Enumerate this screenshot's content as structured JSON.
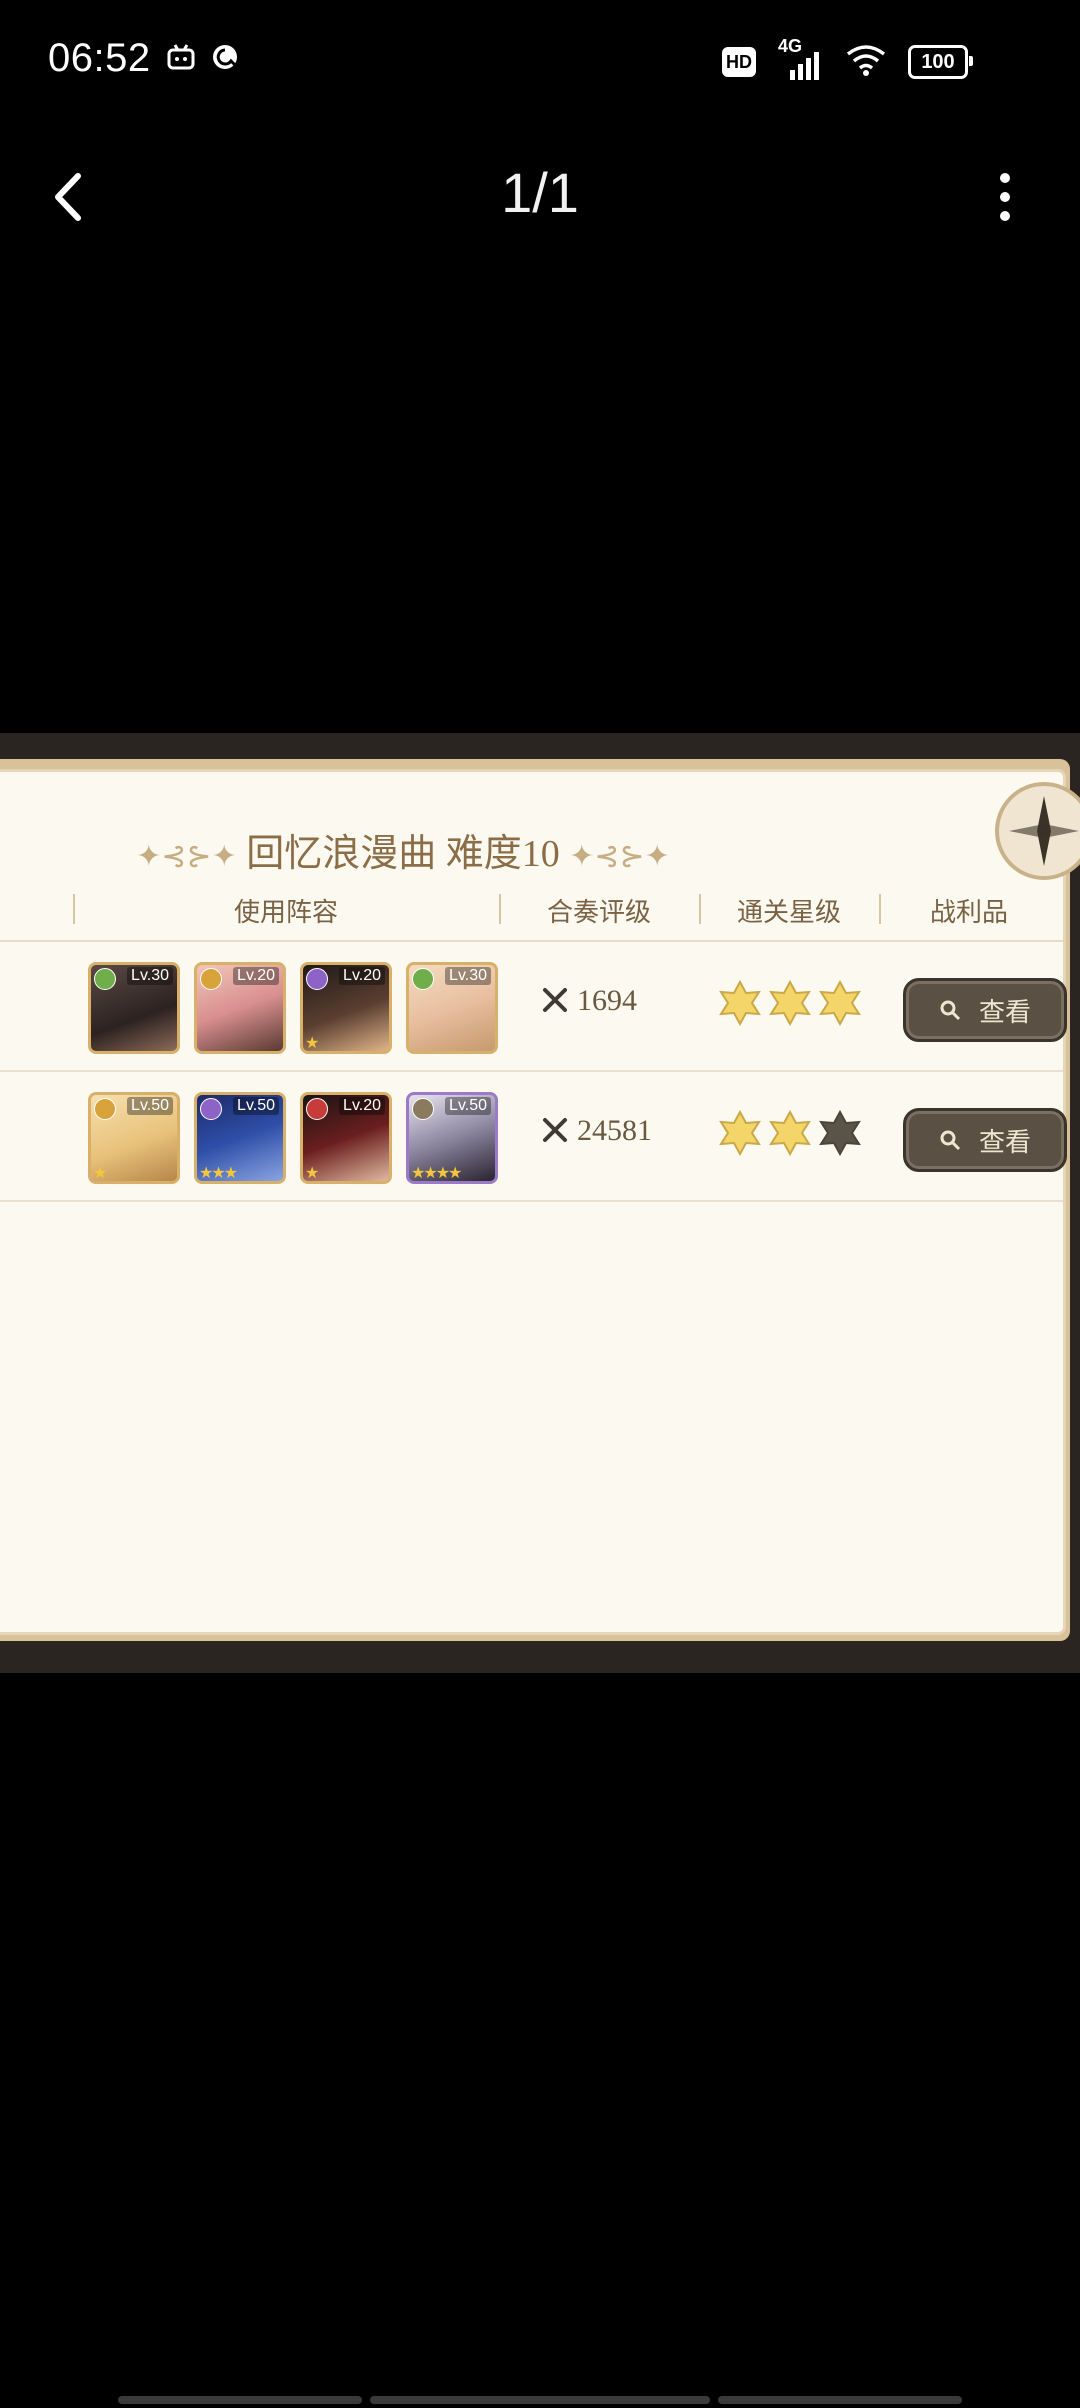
{
  "status_bar": {
    "time": "06:52",
    "hd_label": "HD",
    "network_label": "4G",
    "battery_level": "100"
  },
  "top_bar": {
    "page_counter": "1/1"
  },
  "panel": {
    "title": "回忆浪漫曲 难度10",
    "columns": [
      "使用阵容",
      "合奏评级",
      "通关星级",
      "战利品"
    ],
    "rows": [
      {
        "avatars": [
          {
            "level": "Lv.30",
            "stars": "",
            "element_color": "#6fae4a"
          },
          {
            "level": "Lv.20",
            "stars": "",
            "element_color": "#d9a33b"
          },
          {
            "level": "Lv.20",
            "stars": "★",
            "element_color": "#8e63c8"
          },
          {
            "level": "Lv.30",
            "stars": "",
            "element_color": "#6fae4a"
          }
        ],
        "score": "1694",
        "stars_filled": 3,
        "view_label": "查看"
      },
      {
        "avatars": [
          {
            "level": "Lv.50",
            "stars": "★",
            "element_color": "#d9a33b"
          },
          {
            "level": "Lv.50",
            "stars": "★★★",
            "element_color": "#8e63c8"
          },
          {
            "level": "Lv.20",
            "stars": "★",
            "element_color": "#c83b3b"
          },
          {
            "level": "Lv.50",
            "stars": "★★★★",
            "element_color": "#8a7a5e"
          }
        ],
        "score": "24581",
        "stars_filled": 2,
        "view_label": "查看"
      }
    ]
  },
  "colors": {
    "panel_bg": "#fcf9f0",
    "star_gold": "#f3d56a",
    "star_dark": "#5a5347",
    "button_bg": "#5a5043"
  }
}
